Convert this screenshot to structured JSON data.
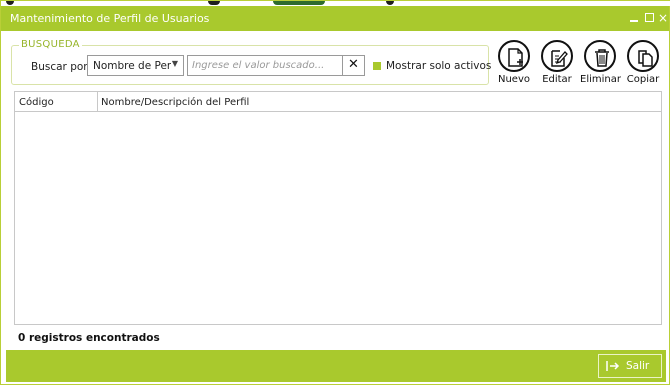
{
  "window": {
    "title": "Mantenimiento de Perfil de Usuarios",
    "controls": {
      "minimize": "minimize-icon",
      "maximize": "maximize-icon",
      "close": "×"
    }
  },
  "colors": {
    "accent": "#a9c92d",
    "legend": "#97b52a"
  },
  "search": {
    "legend": "BUSQUEDA",
    "label": "Buscar por:",
    "field_value": "Nombre de Perfi",
    "placeholder": "Ingrese el valor buscado...",
    "clear_icon": "✕",
    "checkbox_label": "Mostrar solo activos",
    "checkbox_checked": true
  },
  "actions": [
    {
      "label": "Nuevo",
      "icon": "new-document-icon"
    },
    {
      "label": "Editar",
      "icon": "edit-document-icon"
    },
    {
      "label": "Eliminar",
      "icon": "trash-icon"
    },
    {
      "label": "Copiar",
      "icon": "copy-icon"
    }
  ],
  "table": {
    "columns": [
      "Código",
      "Nombre/Descripción del Perfil"
    ],
    "rows": []
  },
  "status": {
    "records": "0 registros encontrados"
  },
  "footer": {
    "exit_label": "Salir",
    "exit_icon": "exit-icon"
  }
}
